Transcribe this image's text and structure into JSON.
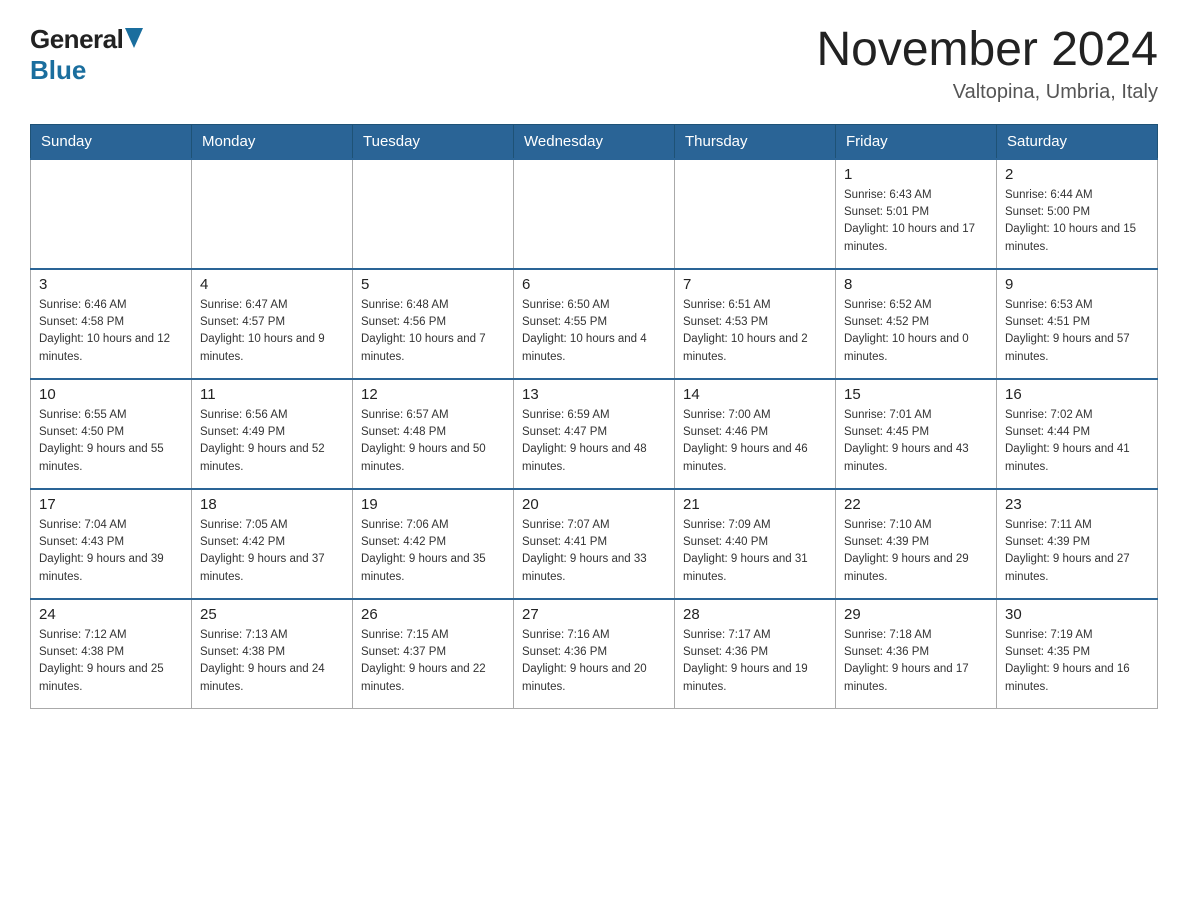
{
  "logo": {
    "general": "General",
    "blue": "Blue"
  },
  "header": {
    "title": "November 2024",
    "subtitle": "Valtopina, Umbria, Italy"
  },
  "days_of_week": [
    "Sunday",
    "Monday",
    "Tuesday",
    "Wednesday",
    "Thursday",
    "Friday",
    "Saturday"
  ],
  "weeks": [
    [
      {
        "day": "",
        "info": ""
      },
      {
        "day": "",
        "info": ""
      },
      {
        "day": "",
        "info": ""
      },
      {
        "day": "",
        "info": ""
      },
      {
        "day": "",
        "info": ""
      },
      {
        "day": "1",
        "info": "Sunrise: 6:43 AM\nSunset: 5:01 PM\nDaylight: 10 hours and 17 minutes."
      },
      {
        "day": "2",
        "info": "Sunrise: 6:44 AM\nSunset: 5:00 PM\nDaylight: 10 hours and 15 minutes."
      }
    ],
    [
      {
        "day": "3",
        "info": "Sunrise: 6:46 AM\nSunset: 4:58 PM\nDaylight: 10 hours and 12 minutes."
      },
      {
        "day": "4",
        "info": "Sunrise: 6:47 AM\nSunset: 4:57 PM\nDaylight: 10 hours and 9 minutes."
      },
      {
        "day": "5",
        "info": "Sunrise: 6:48 AM\nSunset: 4:56 PM\nDaylight: 10 hours and 7 minutes."
      },
      {
        "day": "6",
        "info": "Sunrise: 6:50 AM\nSunset: 4:55 PM\nDaylight: 10 hours and 4 minutes."
      },
      {
        "day": "7",
        "info": "Sunrise: 6:51 AM\nSunset: 4:53 PM\nDaylight: 10 hours and 2 minutes."
      },
      {
        "day": "8",
        "info": "Sunrise: 6:52 AM\nSunset: 4:52 PM\nDaylight: 10 hours and 0 minutes."
      },
      {
        "day": "9",
        "info": "Sunrise: 6:53 AM\nSunset: 4:51 PM\nDaylight: 9 hours and 57 minutes."
      }
    ],
    [
      {
        "day": "10",
        "info": "Sunrise: 6:55 AM\nSunset: 4:50 PM\nDaylight: 9 hours and 55 minutes."
      },
      {
        "day": "11",
        "info": "Sunrise: 6:56 AM\nSunset: 4:49 PM\nDaylight: 9 hours and 52 minutes."
      },
      {
        "day": "12",
        "info": "Sunrise: 6:57 AM\nSunset: 4:48 PM\nDaylight: 9 hours and 50 minutes."
      },
      {
        "day": "13",
        "info": "Sunrise: 6:59 AM\nSunset: 4:47 PM\nDaylight: 9 hours and 48 minutes."
      },
      {
        "day": "14",
        "info": "Sunrise: 7:00 AM\nSunset: 4:46 PM\nDaylight: 9 hours and 46 minutes."
      },
      {
        "day": "15",
        "info": "Sunrise: 7:01 AM\nSunset: 4:45 PM\nDaylight: 9 hours and 43 minutes."
      },
      {
        "day": "16",
        "info": "Sunrise: 7:02 AM\nSunset: 4:44 PM\nDaylight: 9 hours and 41 minutes."
      }
    ],
    [
      {
        "day": "17",
        "info": "Sunrise: 7:04 AM\nSunset: 4:43 PM\nDaylight: 9 hours and 39 minutes."
      },
      {
        "day": "18",
        "info": "Sunrise: 7:05 AM\nSunset: 4:42 PM\nDaylight: 9 hours and 37 minutes."
      },
      {
        "day": "19",
        "info": "Sunrise: 7:06 AM\nSunset: 4:42 PM\nDaylight: 9 hours and 35 minutes."
      },
      {
        "day": "20",
        "info": "Sunrise: 7:07 AM\nSunset: 4:41 PM\nDaylight: 9 hours and 33 minutes."
      },
      {
        "day": "21",
        "info": "Sunrise: 7:09 AM\nSunset: 4:40 PM\nDaylight: 9 hours and 31 minutes."
      },
      {
        "day": "22",
        "info": "Sunrise: 7:10 AM\nSunset: 4:39 PM\nDaylight: 9 hours and 29 minutes."
      },
      {
        "day": "23",
        "info": "Sunrise: 7:11 AM\nSunset: 4:39 PM\nDaylight: 9 hours and 27 minutes."
      }
    ],
    [
      {
        "day": "24",
        "info": "Sunrise: 7:12 AM\nSunset: 4:38 PM\nDaylight: 9 hours and 25 minutes."
      },
      {
        "day": "25",
        "info": "Sunrise: 7:13 AM\nSunset: 4:38 PM\nDaylight: 9 hours and 24 minutes."
      },
      {
        "day": "26",
        "info": "Sunrise: 7:15 AM\nSunset: 4:37 PM\nDaylight: 9 hours and 22 minutes."
      },
      {
        "day": "27",
        "info": "Sunrise: 7:16 AM\nSunset: 4:36 PM\nDaylight: 9 hours and 20 minutes."
      },
      {
        "day": "28",
        "info": "Sunrise: 7:17 AM\nSunset: 4:36 PM\nDaylight: 9 hours and 19 minutes."
      },
      {
        "day": "29",
        "info": "Sunrise: 7:18 AM\nSunset: 4:36 PM\nDaylight: 9 hours and 17 minutes."
      },
      {
        "day": "30",
        "info": "Sunrise: 7:19 AM\nSunset: 4:35 PM\nDaylight: 9 hours and 16 minutes."
      }
    ]
  ]
}
